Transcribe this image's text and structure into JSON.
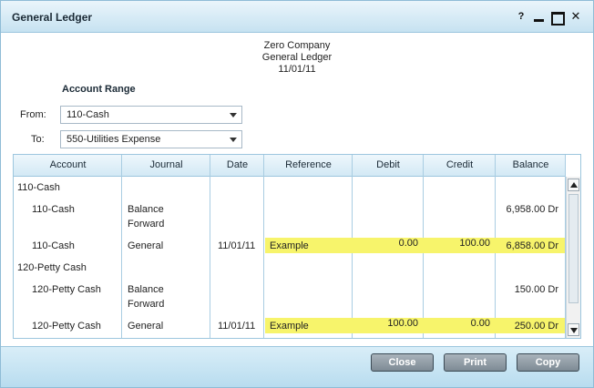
{
  "window": {
    "title": "General Ledger"
  },
  "controls": {
    "help": "?",
    "close": "✕"
  },
  "header": {
    "company": "Zero Company",
    "report": "General Ledger",
    "date": "11/01/11"
  },
  "range": {
    "title": "Account Range",
    "from_label": "From:",
    "from_value": "110-Cash",
    "to_label": "To:",
    "to_value": "550-Utilities Expense"
  },
  "grid": {
    "columns": [
      "Account",
      "Journal",
      "Date",
      "Reference",
      "Debit",
      "Credit",
      "Balance"
    ],
    "rows": [
      {
        "account": "110-Cash",
        "journal": "",
        "journal2": "",
        "date": "",
        "reference": "",
        "debit": "",
        "credit": "",
        "balance": ""
      },
      {
        "account": "110-Cash",
        "journal": "Balance",
        "journal2": "Forward",
        "date": "",
        "reference": "",
        "debit": "",
        "credit": "",
        "balance": "6,958.00 Dr"
      },
      {
        "account": "110-Cash",
        "journal": "General",
        "journal2": "",
        "date": "11/01/11",
        "reference": "Example",
        "debit": "0.00",
        "credit": "100.00",
        "balance": "6,858.00 Dr"
      },
      {
        "account": "120-Petty Cash",
        "journal": "",
        "journal2": "",
        "date": "",
        "reference": "",
        "debit": "",
        "credit": "",
        "balance": ""
      },
      {
        "account": "120-Petty Cash",
        "journal": "Balance",
        "journal2": "Forward",
        "date": "",
        "reference": "",
        "debit": "",
        "credit": "",
        "balance": "150.00 Dr"
      },
      {
        "account": "120-Petty Cash",
        "journal": "General",
        "journal2": "",
        "date": "11/01/11",
        "reference": "Example",
        "debit": "100.00",
        "credit": "0.00",
        "balance": "250.00 Dr"
      }
    ]
  },
  "buttons": {
    "close": "Close",
    "print": "Print",
    "copy": "Copy"
  },
  "colors": {
    "highlight": "#f7f46b",
    "accent": "#9cc6de",
    "button": "#7d8a94"
  }
}
